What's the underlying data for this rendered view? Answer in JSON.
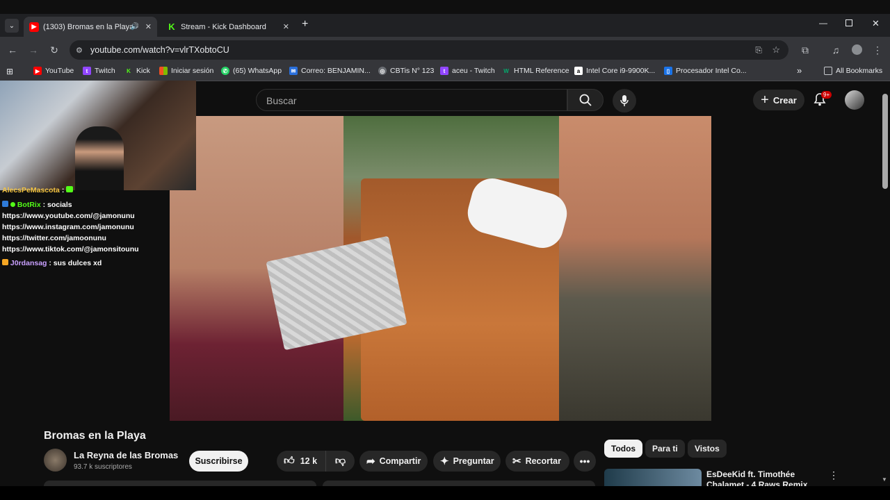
{
  "browser": {
    "tabs": [
      {
        "label": "(1303) Bromas en la Playa -",
        "close": "✕",
        "active": true
      },
      {
        "label": "Stream - Kick Dashboard",
        "close": "✕",
        "active": false
      }
    ],
    "new_tab": "+",
    "url": "youtube.com/watch?v=vlrTXobtoCU",
    "bookmarks": [
      "YouTube",
      "Twitch",
      "Kick",
      "Iniciar sesión",
      "(65) WhatsApp",
      "Correo: BENJAMIN...",
      "CBTis N° 123",
      "aceu - Twitch",
      "HTML Reference",
      "Intel Core i9-9900K...",
      "Procesador Intel Co..."
    ],
    "all_bookmarks": "All Bookmarks",
    "more": "»"
  },
  "youtube": {
    "search_placeholder": "Buscar",
    "create_label": "Crear",
    "notification_badge": "9+",
    "video_title": "Bromas en la Playa",
    "channel_name": "La Reyna de las Bromas",
    "subscribers": "93.7 k suscriptores",
    "subscribe_label": "Suscribirse",
    "likes": "12 k",
    "share_label": "Compartir",
    "ask_label": "Preguntar",
    "clip_label": "Recortar",
    "chips": [
      "Todos",
      "Para ti",
      "Vistos"
    ],
    "rec_title": "EsDeeKid ft. Timothée Chalamet - 4 Raws Remix"
  },
  "chat": {
    "lines": [
      {
        "user": "AlecsPeMascota",
        "text": ":",
        "color": "#f5c542"
      },
      {
        "user": "BotRix",
        "text": ": socials",
        "color": "#53fc18"
      },
      {
        "user": "",
        "text": "https://www.youtube.com/@jamonunu",
        "color": "#ffffff"
      },
      {
        "user": "",
        "text": "https://www.instagram.com/jamonunu",
        "color": "#ffffff"
      },
      {
        "user": "",
        "text": "https://twitter.com/jamoonunu",
        "color": "#ffffff"
      },
      {
        "user": "",
        "text": "https://www.tiktok.com/@jamonsitounu",
        "color": "#ffffff"
      },
      {
        "user": "J0rdansag",
        "text": ": sus dulces xd",
        "color": "#c9a0ff"
      }
    ]
  }
}
